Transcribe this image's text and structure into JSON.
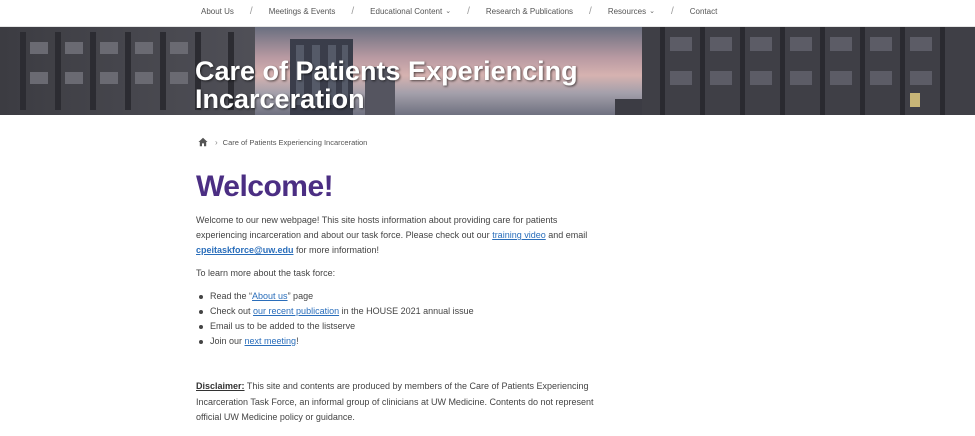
{
  "nav": {
    "items": [
      {
        "label": "About Us",
        "has_dropdown": false
      },
      {
        "label": "Meetings & Events",
        "has_dropdown": false
      },
      {
        "label": "Educational Content",
        "has_dropdown": true
      },
      {
        "label": "Research & Publications",
        "has_dropdown": false
      },
      {
        "label": "Resources",
        "has_dropdown": true
      },
      {
        "label": "Contact",
        "has_dropdown": false
      }
    ],
    "separator": "/",
    "caret": "⌄"
  },
  "hero": {
    "title_line1": "Care of Patients Experiencing",
    "title_line2": "Incarceration"
  },
  "breadcrumb": {
    "separator": "›",
    "current": "Care of Patients Experiencing Incarceration"
  },
  "main": {
    "heading": "Welcome!",
    "intro": {
      "part1": "Welcome to our new webpage! This site hosts information about providing care for patients experiencing incarceration and about our task force. Please check out our ",
      "link_training": "training video",
      "part2": " and email ",
      "link_email": "cpeitaskforce@uw.edu",
      "part3": " for more information!"
    },
    "learn_more": "To learn more about the task force:",
    "list": {
      "item1_pre": "Read the “",
      "item1_link": "About us",
      "item1_post": "” page",
      "item2_pre": "Check out ",
      "item2_link": "our recent publication",
      "item2_post": " in the HOUSE 2021 annual issue",
      "item3": "Email us to be added to the listserve",
      "item4_pre": "Join our ",
      "item4_link": "next meeting",
      "item4_post": "!"
    },
    "disclaimer": {
      "label": "Disclaimer:",
      "text": " This site and contents are produced by members of the Care of Patients Experiencing Incarceration Task Force, an informal group of clinicians at UW Medicine. Contents do not represent official UW Medicine policy or guidance."
    }
  },
  "colors": {
    "heading_purple": "#4b2e83",
    "link_blue": "#2a6ebb",
    "body_text": "#444444"
  },
  "icons": {
    "home": "home-icon"
  }
}
